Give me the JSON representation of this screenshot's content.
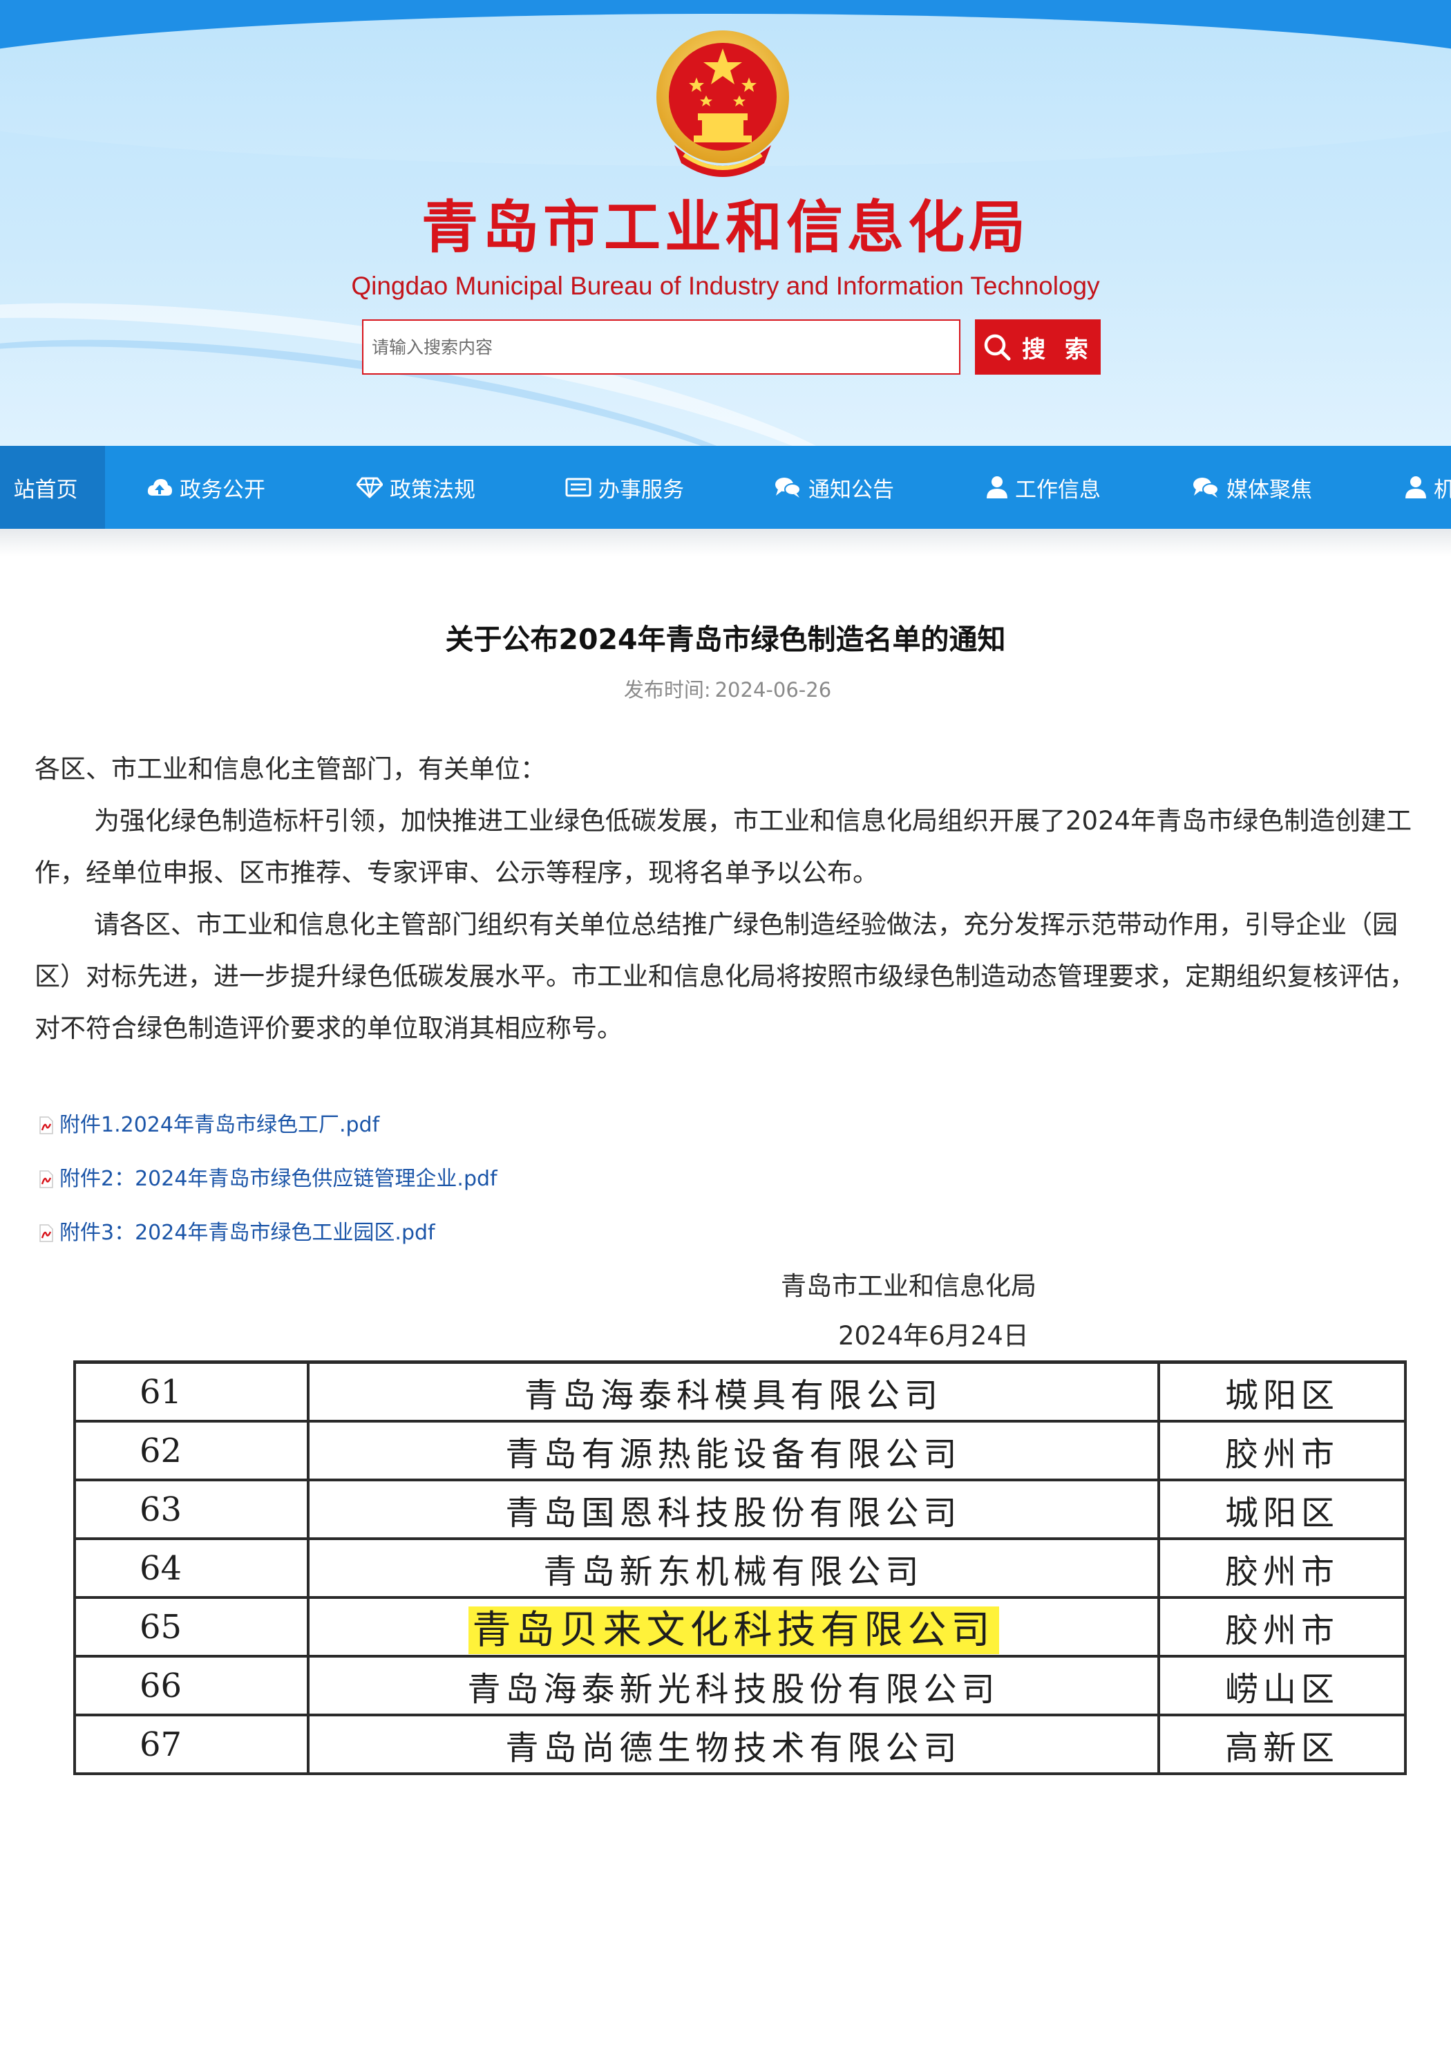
{
  "header": {
    "site_title": "青岛市工业和信息化局",
    "site_subtitle": "Qingdao Municipal Bureau of Industry and Information Technology",
    "search_placeholder": "请输入搜索内容",
    "search_button": "搜 索",
    "emblem_icon": "national-emblem-icon"
  },
  "nav": {
    "items": [
      {
        "label": "站首页",
        "icon": "none"
      },
      {
        "label": "政务公开",
        "icon": "cloud-upload-icon"
      },
      {
        "label": "政策法规",
        "icon": "diamond-icon"
      },
      {
        "label": "办事服务",
        "icon": "card-icon"
      },
      {
        "label": "通知公告",
        "icon": "chat-bubbles-icon"
      },
      {
        "label": "工作信息",
        "icon": "user-icon"
      },
      {
        "label": "媒体聚焦",
        "icon": "chat-bubbles-icon"
      },
      {
        "label": "机",
        "icon": "user-icon"
      }
    ]
  },
  "article": {
    "title": "关于公布2024年青岛市绿色制造名单的通知",
    "publish_label": "发布时间:",
    "publish_date": "2024-06-26",
    "salutation": "各区、市工业和信息化主管部门，有关单位：",
    "paragraphs": [
      "为强化绿色制造标杆引领，加快推进工业绿色低碳发展，市工业和信息化局组织开展了2024年青岛市绿色制造创建工作，经单位申报、区市推荐、专家评审、公示等程序，现将名单予以公布。",
      "请各区、市工业和信息化主管部门组织有关单位总结推广绿色制造经验做法，充分发挥示范带动作用，引导企业（园区）对标先进，进一步提升绿色低碳发展水平。市工业和信息化局将按照市级绿色制造动态管理要求，定期组织复核评估，对不符合绿色制造评价要求的单位取消其相应称号。"
    ],
    "attachments": [
      "附件1.2024年青岛市绿色工厂.pdf",
      "附件2：2024年青岛市绿色供应链管理企业.pdf",
      "附件3：2024年青岛市绿色工业园区.pdf"
    ],
    "signature_org": "青岛市工业和信息化局",
    "signature_date": "2024年6月24日"
  },
  "table": {
    "highlight_color": "#fff23a",
    "rows": [
      {
        "num": "61",
        "company": "青岛海泰科模具有限公司",
        "district": "城阳区",
        "highlighted": false
      },
      {
        "num": "62",
        "company": "青岛有源热能设备有限公司",
        "district": "胶州市",
        "highlighted": false
      },
      {
        "num": "63",
        "company": "青岛国恩科技股份有限公司",
        "district": "城阳区",
        "highlighted": false
      },
      {
        "num": "64",
        "company": "青岛新东机械有限公司",
        "district": "胶州市",
        "highlighted": false
      },
      {
        "num": "65",
        "company": "青岛贝来文化科技有限公司",
        "district": "胶州市",
        "highlighted": true
      },
      {
        "num": "66",
        "company": "青岛海泰新光科技股份有限公司",
        "district": "崂山区",
        "highlighted": false
      },
      {
        "num": "67",
        "company": "青岛尚德生物技术有限公司",
        "district": "高新区",
        "highlighted": false
      }
    ]
  },
  "colors": {
    "brand_red": "#d8141b",
    "nav_blue": "#1a8fe3",
    "link_blue": "#1b55a8"
  }
}
